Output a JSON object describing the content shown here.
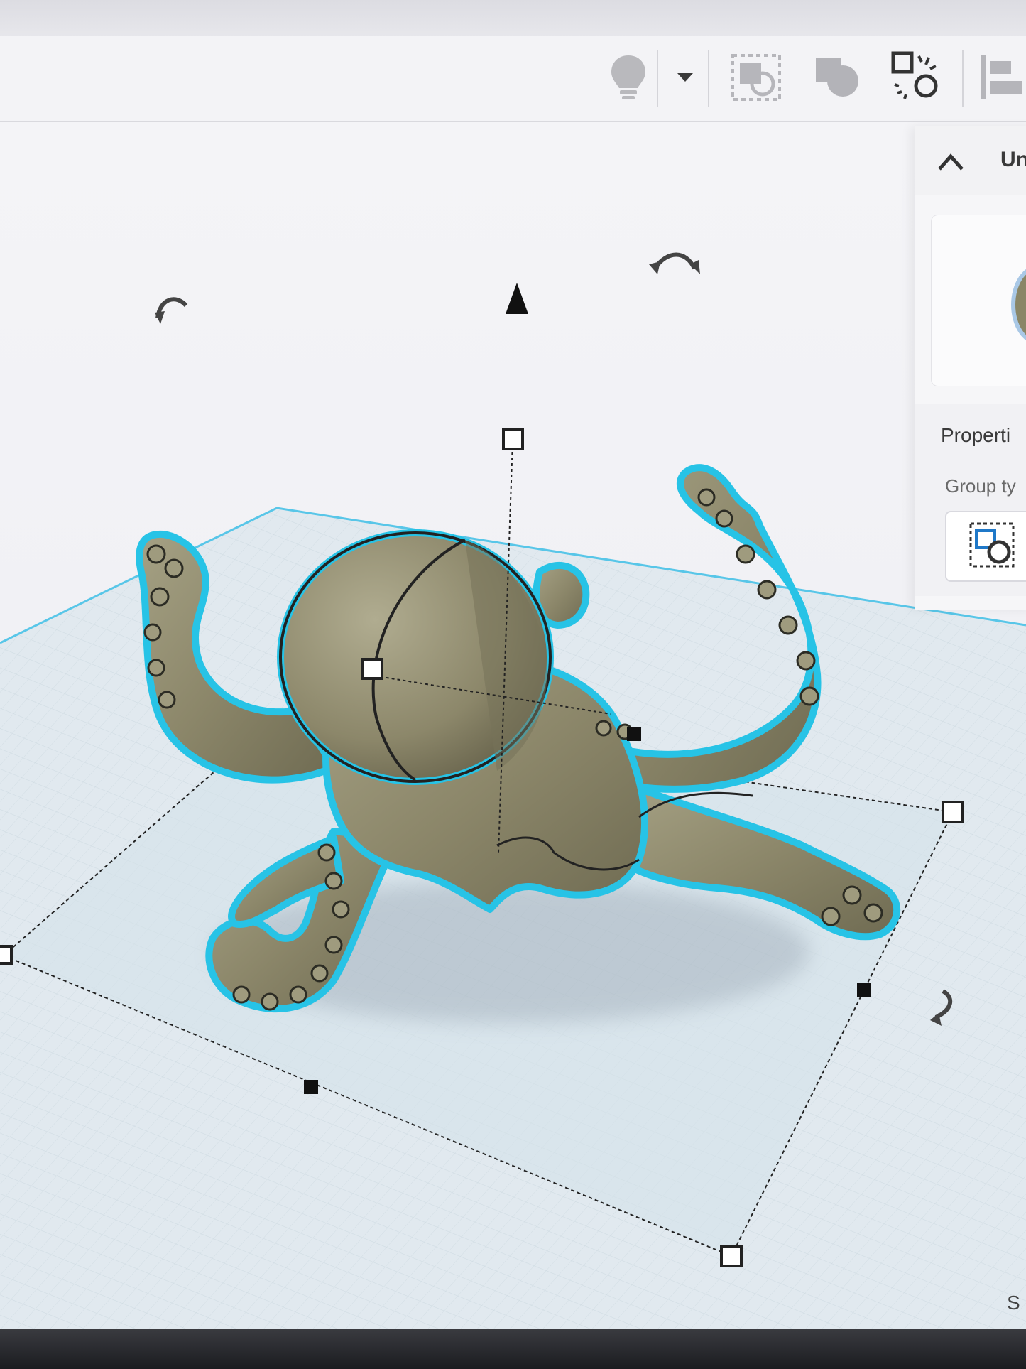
{
  "toolbar": {
    "tools": [
      {
        "icon": "lightbulb-icon"
      },
      {
        "icon": "chevron-down-icon"
      },
      {
        "icon": "group-icon"
      },
      {
        "icon": "ungroup-icon"
      },
      {
        "icon": "workplane-tool-icon"
      },
      {
        "icon": "align-icon"
      }
    ]
  },
  "inspector": {
    "title": "Un",
    "properties_title": "Properti",
    "group_type_label": "Group ty"
  },
  "viewport": {
    "corner_text": "S"
  },
  "colors": {
    "model": "#8c876a",
    "model_shade": "#6f6b52",
    "outline": "#27c3e6",
    "grid": "#c8d6de",
    "workplane": "#dfe8ee",
    "selection": "#222222"
  }
}
